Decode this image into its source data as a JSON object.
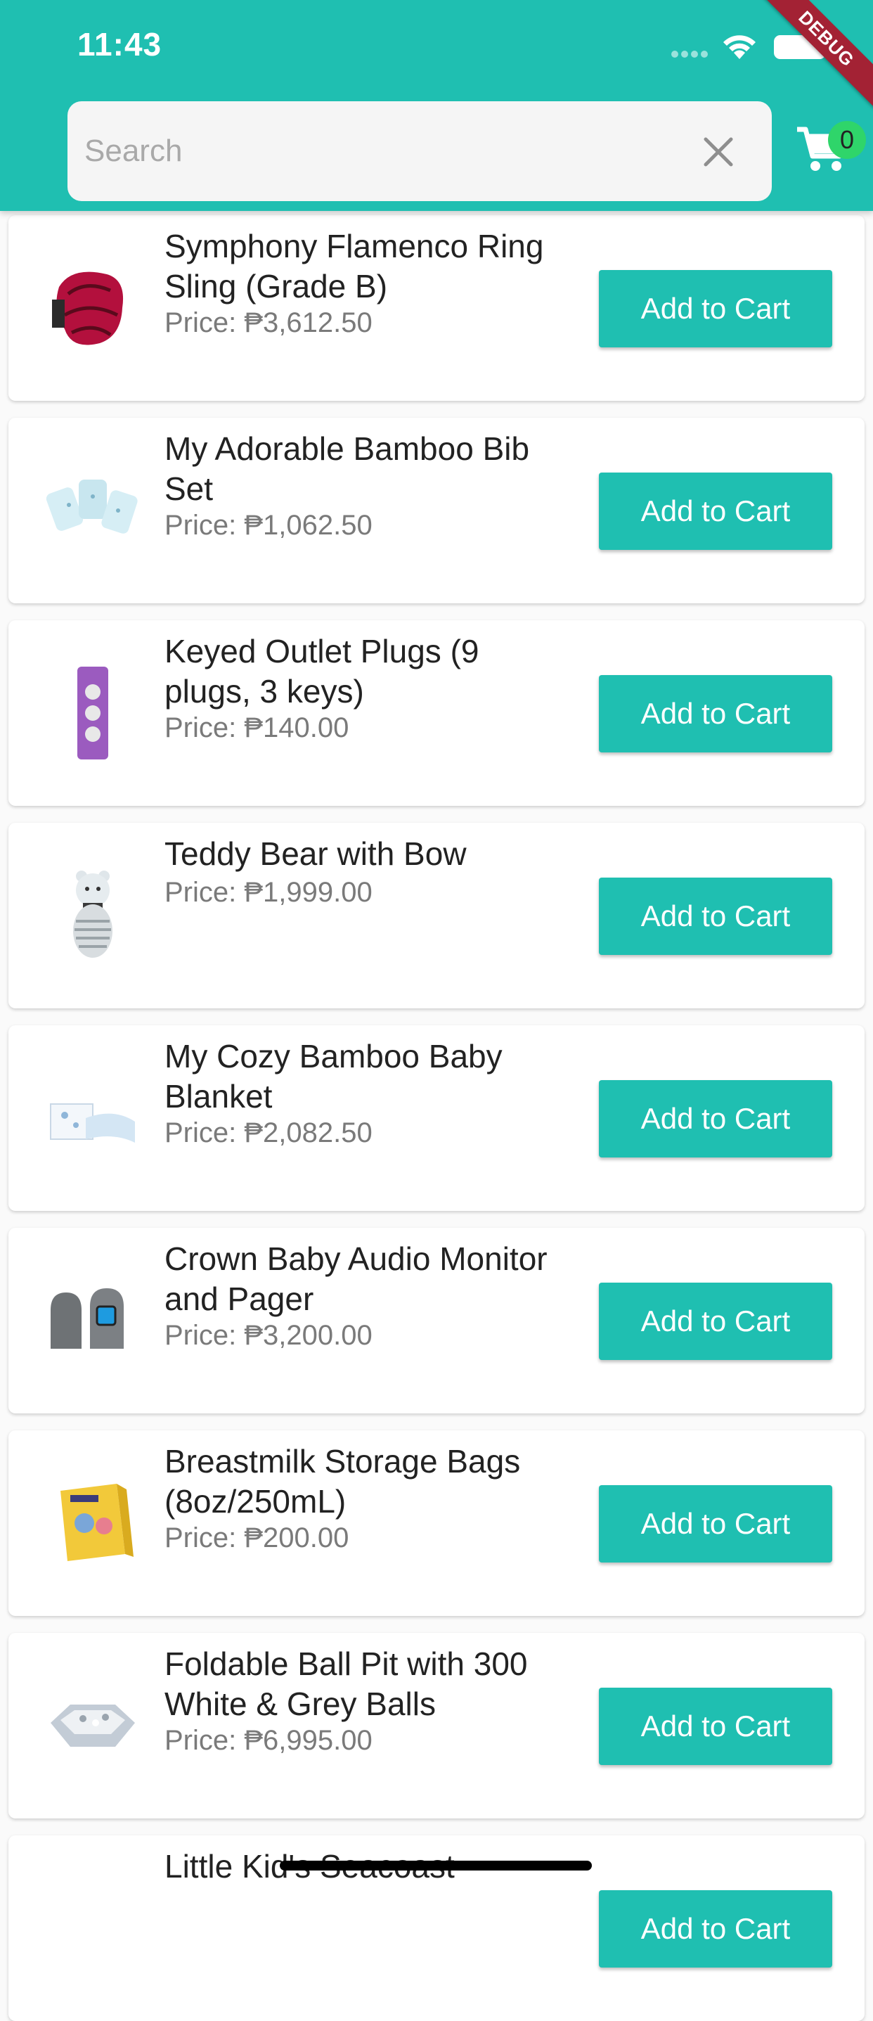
{
  "status_bar": {
    "time": "11:43"
  },
  "debug_banner": "DEBUG",
  "search": {
    "placeholder": "Search",
    "value": ""
  },
  "cart": {
    "count": "0"
  },
  "colors": {
    "primary": "#1fbfb1",
    "badge": "#2fd56a",
    "banner": "#a32234"
  },
  "products": [
    {
      "name": "Symphony Flamenco Ring Sling (Grade B)",
      "price": "Price: ₱3,612.50",
      "button": "Add to Cart",
      "image": "ring-sling-image"
    },
    {
      "name": "My Adorable Bamboo Bib Set",
      "price": "Price: ₱1,062.50",
      "button": "Add to Cart",
      "image": "bib-set-image"
    },
    {
      "name": "Keyed Outlet Plugs (9 plugs, 3 keys)",
      "price": "Price: ₱140.00",
      "button": "Add to Cart",
      "image": "outlet-plugs-image"
    },
    {
      "name": "Teddy Bear with Bow",
      "price": "Price: ₱1,999.00",
      "button": "Add to Cart",
      "image": "teddy-bear-image"
    },
    {
      "name": "My Cozy Bamboo Baby Blanket",
      "price": "Price: ₱2,082.50",
      "button": "Add to Cart",
      "image": "baby-blanket-image"
    },
    {
      "name": "Crown Baby Audio Monitor and Pager",
      "price": "Price: ₱3,200.00",
      "button": "Add to Cart",
      "image": "audio-monitor-image"
    },
    {
      "name": "Breastmilk Storage Bags (8oz/250mL)",
      "price": "Price: ₱200.00",
      "button": "Add to Cart",
      "image": "storage-bags-image"
    },
    {
      "name": "Foldable Ball Pit with 300 White & Grey Balls",
      "price": "Price: ₱6,995.00",
      "button": "Add to Cart",
      "image": "ball-pit-image"
    },
    {
      "name": "Little Kid's Seacoast",
      "price": "",
      "button": "Add to Cart",
      "image": "product-image"
    }
  ]
}
